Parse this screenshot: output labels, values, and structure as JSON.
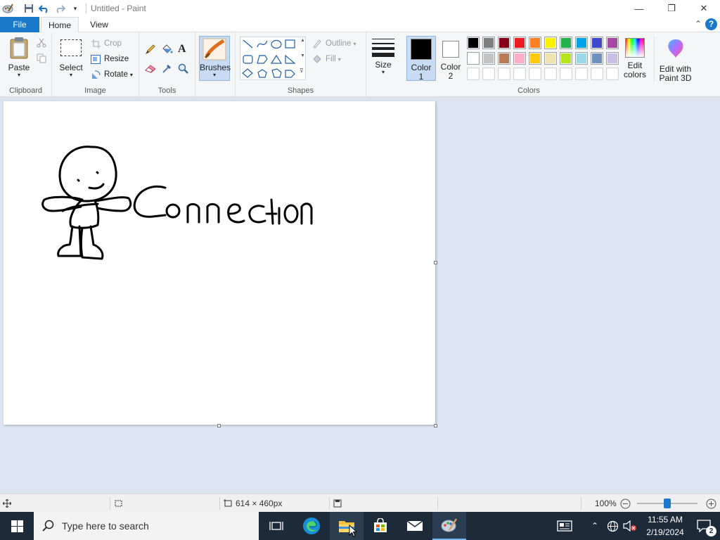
{
  "window": {
    "title": "Untitled - Paint",
    "minimize_glyph": "—",
    "maximize_glyph": "❐",
    "close_glyph": "✕"
  },
  "tabs": {
    "file": "File",
    "home": "Home",
    "view": "View",
    "help": "?",
    "collapse_glyph": "⌃"
  },
  "ribbon": {
    "clipboard": {
      "label": "Clipboard",
      "paste": "Paste"
    },
    "image": {
      "label": "Image",
      "select": "Select",
      "crop": "Crop",
      "resize": "Resize",
      "rotate": "Rotate"
    },
    "tools": {
      "label": "Tools"
    },
    "brushes": {
      "label": "Brushes"
    },
    "shapes": {
      "label": "Shapes",
      "outline": "Outline",
      "fill": "Fill"
    },
    "size": {
      "label": "Size"
    },
    "color1": {
      "label": "Color\n1",
      "line1": "Color",
      "line2": "1",
      "value": "#000000"
    },
    "color2": {
      "line1": "Color",
      "line2": "2",
      "value": "#ffffff"
    },
    "colors": {
      "label": "Colors",
      "row1": [
        "#000000",
        "#7f7f7f",
        "#880015",
        "#ed1c24",
        "#ff7f27",
        "#fff200",
        "#22b14c",
        "#00a2e8",
        "#3f48cc",
        "#a349a4"
      ],
      "row2": [
        "#ffffff",
        "#c3c3c3",
        "#b97a57",
        "#ffaec9",
        "#ffc90e",
        "#efe4b0",
        "#b5e61d",
        "#99d9ea",
        "#7092be",
        "#c8bfe7"
      ],
      "row3": [
        "#ffffff",
        "#ffffff",
        "#ffffff",
        "#ffffff",
        "#ffffff",
        "#ffffff",
        "#ffffff",
        "#ffffff",
        "#ffffff",
        "#ffffff"
      ]
    },
    "edit_colors": {
      "line1": "Edit",
      "line2": "colors"
    },
    "paint3d": {
      "line1": "Edit with",
      "line2": "Paint 3D"
    }
  },
  "canvas": {
    "drawn_text": "Connection"
  },
  "status": {
    "dimensions": "614 × 460px",
    "zoom": "100%",
    "zoom_level": 0.5
  },
  "taskbar": {
    "search_placeholder": "Type here to search",
    "time": "11:55 AM",
    "date": "2/19/2024",
    "notification_count": "2"
  }
}
